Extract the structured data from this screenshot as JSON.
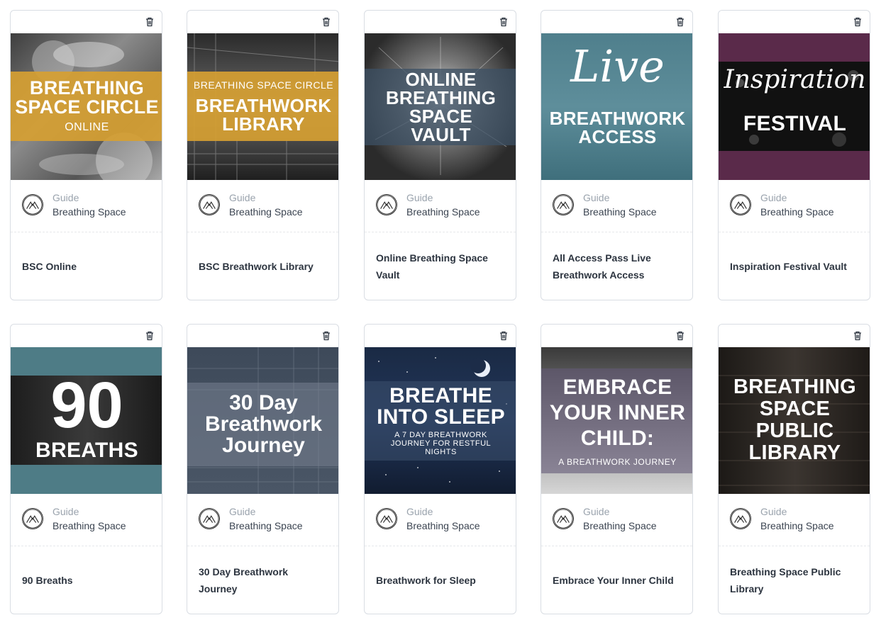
{
  "guide_label": "Guide",
  "cards": [
    {
      "title": "BSC Online",
      "guide": "Breathing Space",
      "cover": {
        "lines": [
          "BREATHING",
          "SPACE CIRCLE"
        ],
        "sub": "ONLINE"
      }
    },
    {
      "title": "BSC Breathwork Library",
      "guide": "Breathing Space",
      "cover": {
        "pre": "BREATHING SPACE CIRCLE",
        "lines": [
          "BREATHWORK",
          "LIBRARY"
        ]
      }
    },
    {
      "title": "Online Breathing Space Vault",
      "guide": "Breathing Space",
      "cover": {
        "lines": [
          "ONLINE",
          "BREATHING",
          "SPACE",
          "VAULT"
        ]
      }
    },
    {
      "title": "All Access Pass Live Breathwork Access",
      "guide": "Breathing Space",
      "cover": {
        "script": "Live",
        "lines": [
          "BREATHWORK",
          "ACCESS"
        ]
      }
    },
    {
      "title": "Inspiration Festival Vault",
      "guide": "Breathing Space",
      "cover": {
        "script": "Inspiration",
        "lines": [
          "FESTIVAL"
        ]
      }
    },
    {
      "title": "90 Breaths",
      "guide": "Breathing Space",
      "cover": {
        "big": "90",
        "lines": [
          "BREATHS"
        ]
      }
    },
    {
      "title": "30 Day Breathwork Journey",
      "guide": "Breathing Space",
      "cover": {
        "lines": [
          "30 Day",
          "Breathwork",
          "Journey"
        ]
      }
    },
    {
      "title": "Breathwork for Sleep",
      "guide": "Breathing Space",
      "cover": {
        "lines": [
          "BREATHE",
          "INTO SLEEP"
        ],
        "sub": "A 7 DAY BREATHWORK JOURNEY FOR RESTFUL NIGHTS"
      }
    },
    {
      "title": "Embrace Your Inner Child",
      "guide": "Breathing Space",
      "cover": {
        "lines": [
          "EMBRACE",
          "YOUR INNER",
          "CHILD:"
        ],
        "sub": "A BREATHWORK JOURNEY"
      }
    },
    {
      "title": "Breathing Space Public Library",
      "guide": "Breathing Space",
      "cover": {
        "lines": [
          "BREATHING",
          "SPACE",
          "PUBLIC",
          "LIBRARY"
        ]
      }
    }
  ]
}
